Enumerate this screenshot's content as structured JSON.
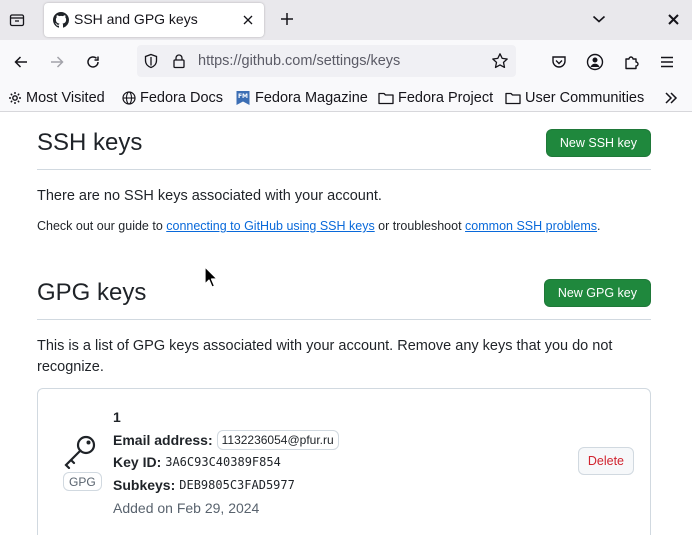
{
  "browser": {
    "tab": {
      "title": "SSH and GPG keys",
      "favicon": "github-icon"
    },
    "url": "https://github.com/settings/keys",
    "bookmarks": [
      {
        "label": "Most Visited",
        "icon": "gear-icon"
      },
      {
        "label": "Fedora Docs",
        "icon": "globe-icon"
      },
      {
        "label": "Fedora Magazine",
        "icon": "fedora-magazine-icon"
      },
      {
        "label": "Fedora Project",
        "icon": "folder-icon"
      },
      {
        "label": "User Communities",
        "icon": "folder-icon"
      }
    ]
  },
  "ssh": {
    "title": "SSH keys",
    "new_button": "New SSH key",
    "empty_text": "There are no SSH keys associated with your account.",
    "guide_prefix": "Check out our guide to ",
    "guide_link": "connecting to GitHub using SSH keys",
    "guide_middle": " or troubleshoot ",
    "problems_link": "common SSH problems",
    "guide_suffix": "."
  },
  "gpg": {
    "title": "GPG keys",
    "new_button": "New GPG key",
    "description": "This is a list of GPG keys associated with your account. Remove any keys that you do not recognize.",
    "key": {
      "name": "1",
      "badge": "GPG",
      "email_label": "Email address:",
      "email": "1132236054@pfur.ru",
      "key_id_label": "Key ID:",
      "key_id": "3A6C93C40389F854",
      "subkeys_label": "Subkeys:",
      "subkeys": "DEB9805C3FAD5977",
      "added": "Added on Feb 29, 2024",
      "delete_button": "Delete"
    }
  },
  "colors": {
    "primary_button": "#1f883d",
    "link": "#0969da",
    "danger": "#d1242f"
  }
}
